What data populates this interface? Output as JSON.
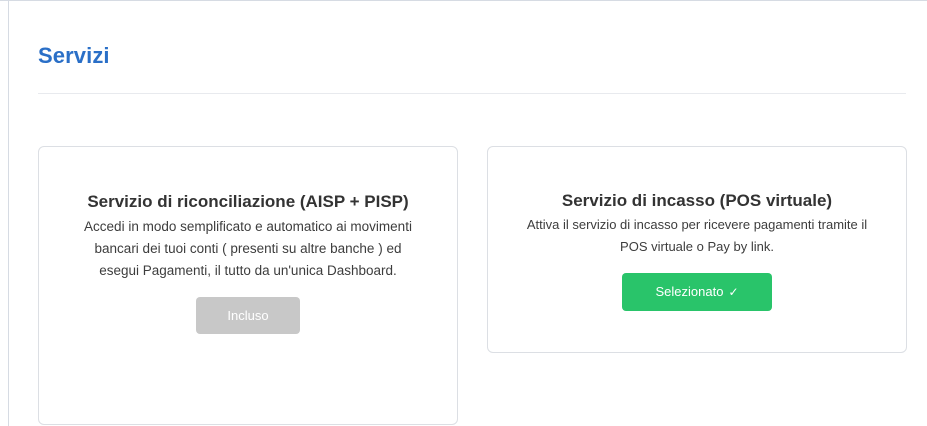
{
  "page": {
    "title": "Servizi"
  },
  "services": [
    {
      "title": "Servizio di riconciliazione (AISP + PISP)",
      "description": "Accedi in modo semplificato e automatico ai movimenti bancari dei tuoi conti ( presenti su altre banche ) ed esegui Pagamenti, il tutto da un'unica Dashboard.",
      "button_label": "Incluso",
      "button_state": "disabled"
    },
    {
      "title": "Servizio di incasso (POS virtuale)",
      "description": "Attiva il servizio di incasso per ricevere pagamenti tramite il POS virtuale o Pay by link.",
      "button_label": "Selezionato",
      "button_icon": "checkmark-icon",
      "button_icon_glyph": "✓",
      "button_state": "selected"
    }
  ],
  "colors": {
    "title_blue": "#2a6fc7",
    "included_gray": "#c8c8c8",
    "selected_green": "#29c46a"
  }
}
